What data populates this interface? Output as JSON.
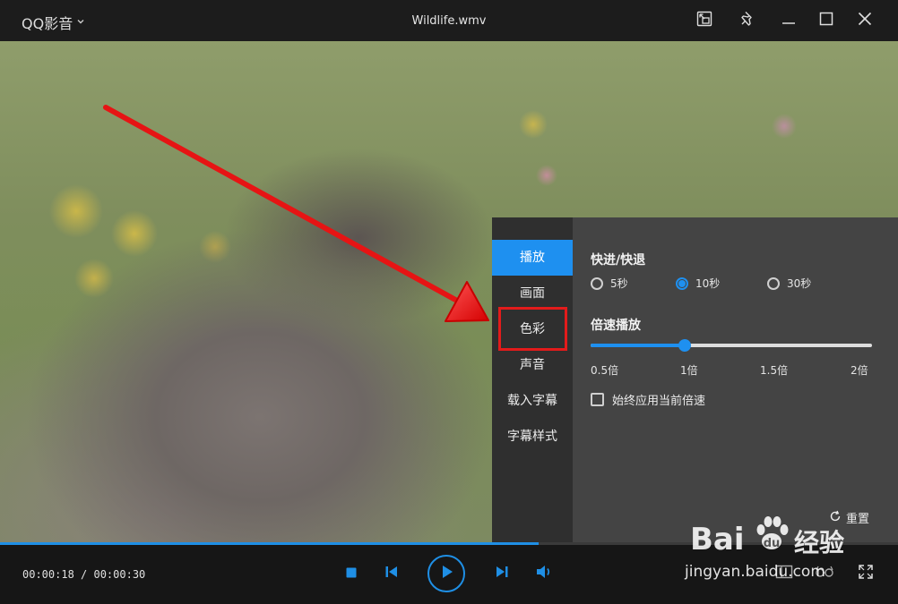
{
  "app": {
    "name": "QQ影音",
    "file_title": "Wildlife.wmv"
  },
  "player": {
    "time_display": "00:00:18 / 00:00:30",
    "progress": 0.6
  },
  "settings_panel": {
    "nav_items": [
      {
        "label": "播放",
        "active": true
      },
      {
        "label": "画面",
        "active": false
      },
      {
        "label": "色彩",
        "active": false
      },
      {
        "label": "声音",
        "active": false
      },
      {
        "label": "载入字幕",
        "active": false
      },
      {
        "label": "字幕样式",
        "active": false
      }
    ],
    "seek_section": {
      "title": "快进/快退",
      "options": [
        {
          "label": "5秒",
          "selected": false
        },
        {
          "label": "10秒",
          "selected": true
        },
        {
          "label": "30秒",
          "selected": false
        }
      ]
    },
    "speed_section": {
      "title": "倍速播放",
      "ticks": [
        "0.5倍",
        "1倍",
        "1.5倍",
        "2倍"
      ],
      "value": 1,
      "min": 0.5,
      "max": 2
    },
    "always_apply_label": "始终应用当前倍速",
    "always_apply_checked": false,
    "reset_label": "重置"
  },
  "watermark": {
    "brand": "Bai",
    "brand_cn": "经验",
    "url": "jingyan.baidu.com"
  },
  "colors": {
    "accent": "#1e90f0",
    "annotation": "#e31b1b",
    "panel": "#444444",
    "nav": "#2f2f2f"
  },
  "icons": [
    "chevron-down-icon",
    "mini-mode-icon",
    "pin-icon",
    "minimize-icon",
    "maximize-icon",
    "close-icon",
    "stop-icon",
    "previous-icon",
    "play-icon",
    "next-icon",
    "volume-icon",
    "screenshot-icon",
    "vr-glasses-icon",
    "fullscreen-icon",
    "refresh-icon",
    "paw-icon"
  ]
}
